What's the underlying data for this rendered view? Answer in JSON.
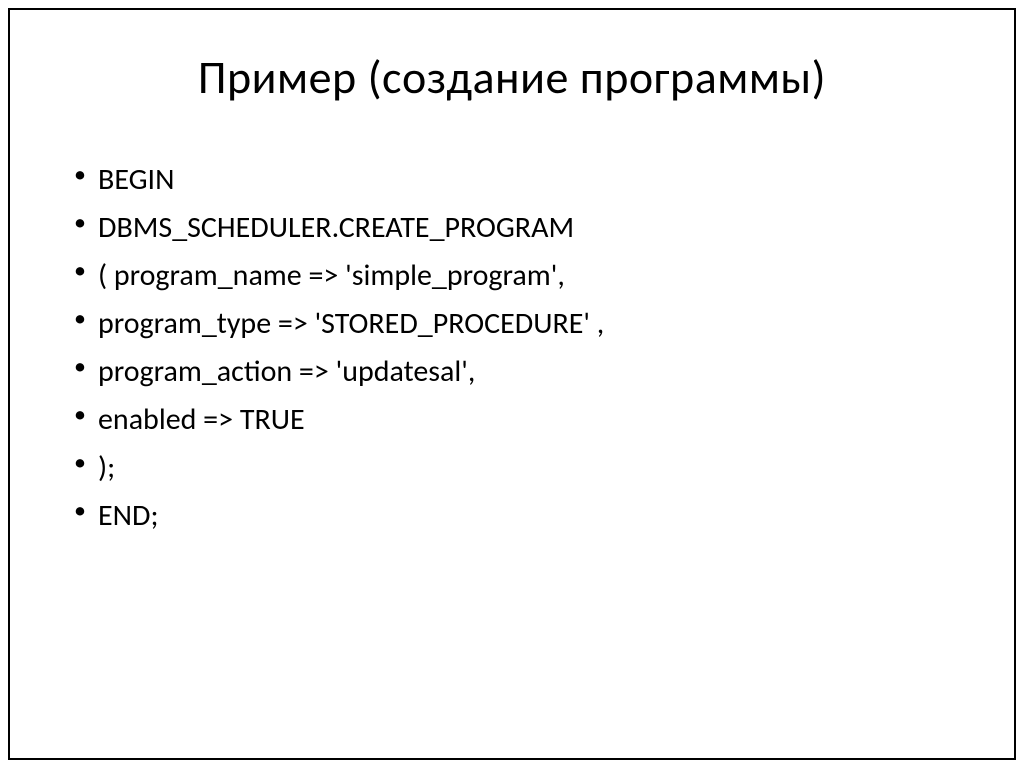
{
  "slide": {
    "title": "Пример (создание программы)",
    "bullets": [
      "BEGIN",
      "DBMS_SCHEDULER.CREATE_PROGRAM",
      "( program_name  => 'simple_program',",
      "  program_type  => 'STORED_PROCEDURE' ,",
      "  program_action => 'updatesal',",
      "  enabled        => TRUE",
      ");",
      "END;"
    ]
  }
}
